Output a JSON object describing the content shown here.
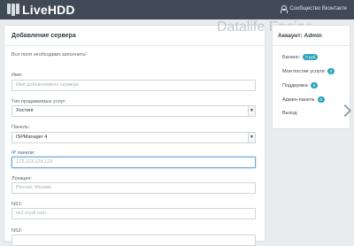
{
  "header": {
    "logo_text": "LiveHDD",
    "user_link": "Сообщество Вконтакте"
  },
  "watermark": "Datalife Engine",
  "form": {
    "title": "Добавление сервера",
    "note": "Все поля необходимо заполнить!",
    "fields": {
      "name": {
        "label": "Имя:",
        "placeholder": "Имя добавляемого сервера"
      },
      "service_type": {
        "label": "Тип продаваемых услуг:",
        "value": "Хостинг"
      },
      "panel": {
        "label": "Панель:",
        "value": "ISPManager 4"
      },
      "ip": {
        "label": "IP панели:",
        "placeholder": "123.123.123.123"
      },
      "location": {
        "label": "Локация:",
        "placeholder": "Россия, Москва"
      },
      "ns1": {
        "label": "NS1:",
        "placeholder": "ns1.mydi.com"
      },
      "ns2": {
        "label": "NS2:"
      }
    }
  },
  "account": {
    "title": "Аккаунт: Admin",
    "items": [
      {
        "label": "Баланс:",
        "badge": "0 руб"
      },
      {
        "label": "Мои постие услуги",
        "badge": "0"
      },
      {
        "label": "Поддержка",
        "badge": "0"
      },
      {
        "label": "Админ-панель",
        "badge": "0"
      },
      {
        "label": "Выход",
        "badge": ""
      }
    ]
  },
  "colors": {
    "topbar": "#3f4a56",
    "badge": "#2fa3bf",
    "focus": "#6aa7d8"
  }
}
